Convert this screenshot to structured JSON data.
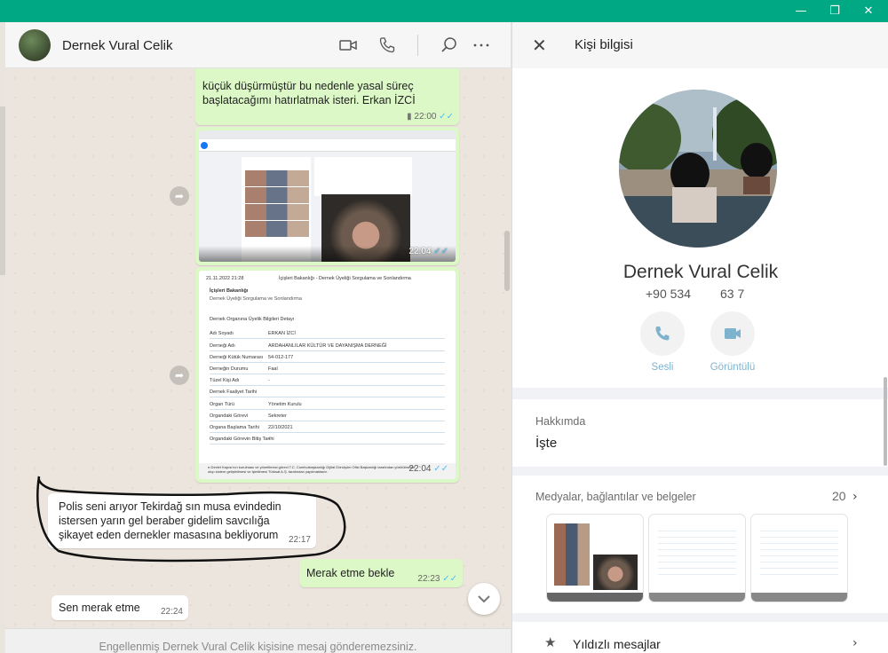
{
  "window": {
    "minimize_glyph": "—",
    "restore_glyph": "❐",
    "close_glyph": "✕"
  },
  "chat": {
    "contact_name": "Dernek Vural Celik",
    "header_icons": [
      "video-call-icon",
      "voice-call-icon",
      "search-icon",
      "more-options-icon"
    ],
    "messages": [
      {
        "type": "text-out",
        "text": "küçük düşürmüştür bu nedenle yasal süreç başlatacağımı hatırlatmak isteri. Erkan İZCİ",
        "time": "22:00"
      },
      {
        "type": "image-out",
        "caption": "Facebook profile screenshot",
        "time": "22:04"
      },
      {
        "type": "image-out",
        "caption": "Dernek Üyeliği Sorgulama document",
        "time": "22:04"
      },
      {
        "type": "text-in",
        "text": "Polis seni arıyor Tekirdağ sın musa evindedin istersen yarın gel beraber gidelim savcılığa şikayet eden dernekler masasına bekliyorum",
        "time": "22:17"
      },
      {
        "type": "text-out",
        "text": "Merak etme bekle",
        "time": "22:23"
      },
      {
        "type": "text-in",
        "text": "Sen merak etme",
        "time": "22:24"
      }
    ],
    "document": {
      "date": "21.11.2022 21:28",
      "heading": "İçişleri Bakanlığı - Dernek Üyeliği Sorgulama ve Sonlandırma",
      "breadcrumb_title": "İçişleri Bakanlığı",
      "breadcrumb_sub": "Dernek Üyeliği Sorgulama ve Sonlandırma",
      "section": "Dernek Organına Üyelik Bilgileri Detayı",
      "rows": [
        [
          "Adı Soyadı",
          "ERKAN İZCİ"
        ],
        [
          "Derneği Adı",
          "ARDAHANLILAR KÜLTÜR VE DAYANIŞMA DERNEĞİ"
        ],
        [
          "Derneği Kütük Numarası",
          "54-012-177"
        ],
        [
          "Derneğin Durumu",
          "Faal"
        ],
        [
          "Tüzel Kişi Adı",
          "-"
        ],
        [
          "Dernek Faaliyet Tarihi",
          ""
        ],
        [
          "Organ Türü",
          "Yönetim Kurulu"
        ],
        [
          "Organdaki Görevi",
          "Sekreter"
        ],
        [
          "Organa Başlama Tarihi",
          "22/10/2021"
        ],
        [
          "Organdaki Görevin Bitiş Tarihi",
          "-"
        ]
      ],
      "footer": "e-Devlet Kapısı'nın kurulması ve yönetilmesi görevi T.C. Cumhurbaşkanlığı Dijital Dönüşüm Ofisi Başkanlığı tarafından yürütülmekte olup sistem geliştirilmesi ve işletilmesi Türksat A.Ş. tarafından yapılmaktadır."
    },
    "blocked_text": "Engellenmiş Dernek Vural Celik kişisine mesaj gönderemezsiniz."
  },
  "info": {
    "title": "Kişi bilgisi",
    "name": "Dernek Vural Celik",
    "phone_part1": "+90 534",
    "phone_part2": "63 7",
    "voice_label": "Sesli",
    "video_label": "Görüntülü",
    "about_label": "Hakkımda",
    "about_text": "İşte",
    "media_label": "Medyalar, bağlantılar ve belgeler",
    "media_count": "20",
    "starred_label": "Yıldızlı mesajlar"
  },
  "colors": {
    "accent": "#00a884",
    "bubble_out": "#dcf8c6",
    "tick_read": "#53bdeb"
  }
}
